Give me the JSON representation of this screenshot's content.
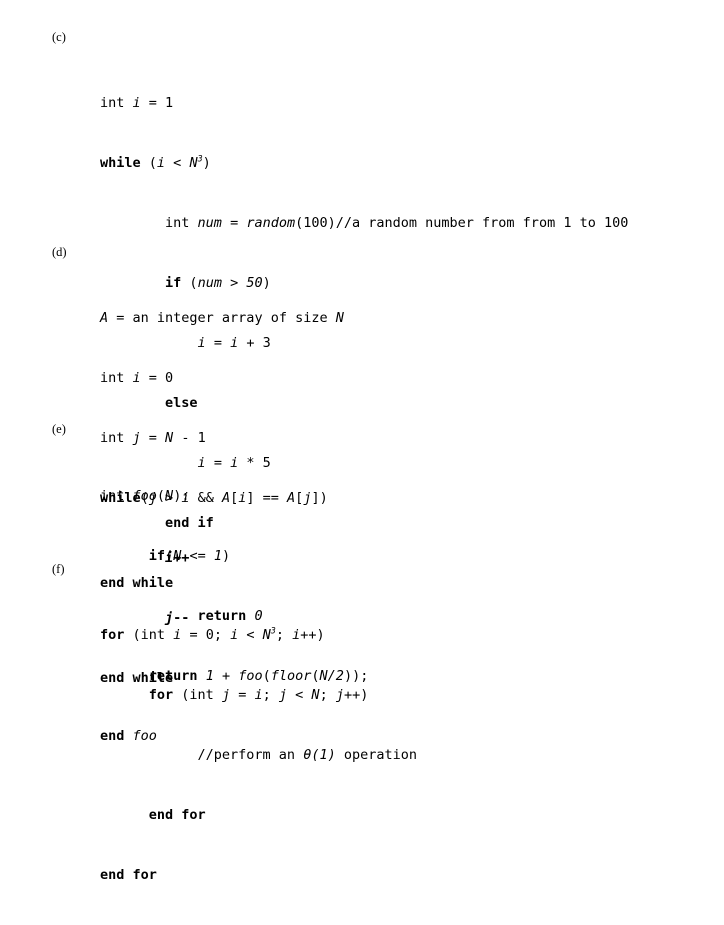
{
  "document": {
    "background_color": "#ffffff",
    "text_color": "#000000",
    "clipped_top_line": "end while",
    "parts": [
      {
        "label": "(c)",
        "lines": [
          "int i = 1",
          "while (i < N3)",
          "        int num = random(100)//a random number from from 1 to 100",
          "        if (num > 50)",
          "            i = i + 3",
          "        else",
          "            i = i * 5",
          "        end if",
          "end while"
        ]
      },
      {
        "label": "(d)",
        "lines": [
          "A = an integer array of size N",
          "int i = 0",
          "int j = N - 1",
          "while(j > i && A[i] == A[j])",
          "        i++",
          "        j--",
          "end while"
        ]
      },
      {
        "label": "(e)",
        "lines": [
          "int foo(N):",
          "      if(N <= 1)",
          "            return 0",
          "      return 1 + foo(floor(N/2));",
          "end foo"
        ]
      },
      {
        "label": "(f)",
        "lines": [
          "for (int i = 0; i < N3; i++)",
          "      for (int j = i; j < N; j++)",
          "            //perform an θ(1) operation",
          "      end for",
          "end for"
        ]
      }
    ]
  }
}
